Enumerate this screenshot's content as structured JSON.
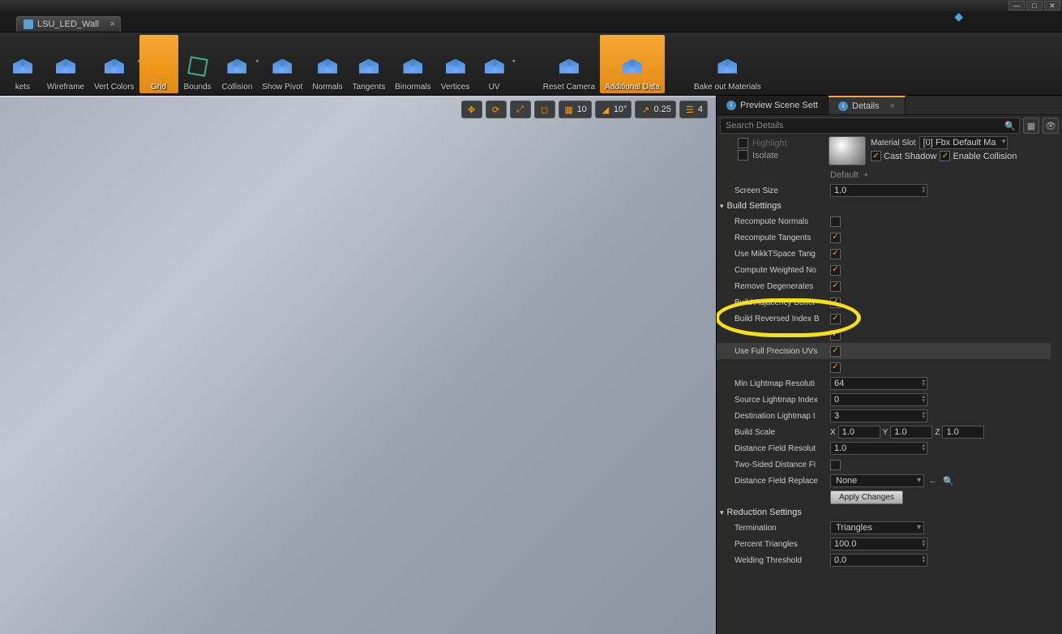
{
  "window": {
    "tab_title": "LSU_LED_Wall"
  },
  "toolbar": [
    {
      "label": "kets",
      "active": false
    },
    {
      "label": "Wireframe",
      "active": false
    },
    {
      "label": "Vert Colors",
      "active": false,
      "dd": true
    },
    {
      "label": "Grid",
      "active": true
    },
    {
      "label": "Bounds",
      "active": false
    },
    {
      "label": "Collision",
      "active": false,
      "dd": true
    },
    {
      "label": "Show Pivot",
      "active": false
    },
    {
      "label": "Normals",
      "active": false
    },
    {
      "label": "Tangents",
      "active": false
    },
    {
      "label": "Binormals",
      "active": false
    },
    {
      "label": "Vertices",
      "active": false
    },
    {
      "label": "UV",
      "active": false,
      "dd": true
    },
    {
      "label": "Reset Camera",
      "active": false,
      "gap": true
    },
    {
      "label": "Additional Data",
      "active": true
    },
    {
      "label": "Bake out Materials",
      "active": false,
      "gap": true
    }
  ],
  "viewport_overlay": {
    "grid_val": "10",
    "angle_val": "10°",
    "scale_val": "0.25",
    "speed_val": "4"
  },
  "right_tabs": {
    "t1": "Preview Scene Sett",
    "t2": "Details"
  },
  "search_placeholder": "Search Details",
  "mat": {
    "highlight": "Highlight",
    "isolate": "Isolate",
    "slot_label": "Material Slot",
    "slot_value": "[0] Fbx Default Ma",
    "cast_shadow": "Cast Shadow",
    "enable_collision": "Enable Collision"
  },
  "screen_size": {
    "label": "Screen Size",
    "default": "Default",
    "value": "1.0"
  },
  "build_settings": {
    "header": "Build Settings",
    "rows": [
      {
        "label": "Recompute Normals",
        "type": "chk",
        "on": false
      },
      {
        "label": "Recompute Tangents",
        "type": "chk",
        "on": true
      },
      {
        "label": "Use MikkTSpace Tang",
        "type": "chk",
        "on": true
      },
      {
        "label": "Compute Weighted No",
        "type": "chk",
        "on": true
      },
      {
        "label": "Remove Degenerates",
        "type": "chk",
        "on": true
      },
      {
        "label": "Build Adjacency Buffer",
        "type": "chk",
        "on": true
      },
      {
        "label": "Build Reversed Index B",
        "type": "chk",
        "on": true
      },
      {
        "label": "",
        "type": "chk",
        "on": true,
        "obscured": true
      },
      {
        "label": "Use Full Precision UVs",
        "type": "chk",
        "on": true,
        "highlight": true
      },
      {
        "label": "",
        "type": "chk",
        "on": true,
        "obscured": true
      },
      {
        "label": "Min Lightmap Resoluti",
        "type": "num",
        "value": "64"
      },
      {
        "label": "Source Lightmap Index",
        "type": "num",
        "value": "0"
      },
      {
        "label": "Destination Lightmap I",
        "type": "num",
        "value": "3"
      },
      {
        "label": "Build Scale",
        "type": "vec",
        "x": "1.0",
        "y": "1.0",
        "z": "1.0"
      },
      {
        "label": "Distance Field Resolut",
        "type": "num",
        "value": "1.0"
      },
      {
        "label": "Two-Sided Distance Fi",
        "type": "chk",
        "on": false
      },
      {
        "label": "Distance Field Replace",
        "type": "dd",
        "value": "None",
        "extra": true
      },
      {
        "label": "",
        "type": "btn",
        "value": "Apply Changes"
      }
    ]
  },
  "reduction": {
    "header": "Reduction Settings",
    "rows": [
      {
        "label": "Termination",
        "type": "dd",
        "value": "Triangles"
      },
      {
        "label": "Percent Triangles",
        "type": "num",
        "value": "100.0"
      },
      {
        "label": "Welding Threshold",
        "type": "num",
        "value": "0.0"
      }
    ]
  }
}
